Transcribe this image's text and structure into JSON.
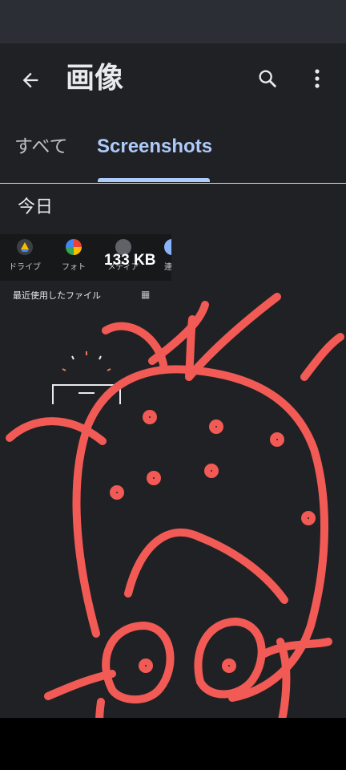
{
  "header": {
    "title": "画像"
  },
  "tabs": [
    {
      "label": "すべて",
      "selected": false
    },
    {
      "label": "Screenshots",
      "selected": true
    }
  ],
  "section": {
    "title": "今日"
  },
  "thumbnail": {
    "size_label": "133 KB",
    "apps": [
      {
        "label": "ドライブ",
        "icon": "drive-icon"
      },
      {
        "label": "フォト",
        "icon": "photos-icon"
      },
      {
        "label": "メディア",
        "icon": "media-icon"
      },
      {
        "label": "連絡",
        "icon": "contacts-icon"
      }
    ],
    "recent_label": "最近使用したファイル"
  },
  "colors": {
    "background": "#202124",
    "accent": "#aecbfa",
    "doodle": "#f25a55"
  }
}
